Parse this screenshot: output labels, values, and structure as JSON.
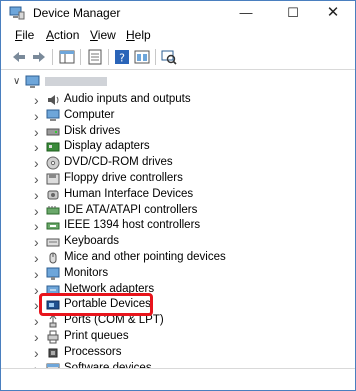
{
  "window": {
    "title": "Device Manager"
  },
  "controls": {
    "minimize": "—",
    "maximize": "☐",
    "close": "✕"
  },
  "menu": [
    {
      "label": "File",
      "u": "F",
      "rest": "ile"
    },
    {
      "label": "Action",
      "u": "A",
      "rest": "ction"
    },
    {
      "label": "View",
      "u": "V",
      "rest": "iew"
    },
    {
      "label": "Help",
      "u": "H",
      "rest": "elp"
    }
  ],
  "tree": {
    "items": [
      {
        "label": "Audio inputs and outputs",
        "icon": "speaker-icon"
      },
      {
        "label": "Computer",
        "icon": "computer-icon"
      },
      {
        "label": "Disk drives",
        "icon": "disk-drive-icon"
      },
      {
        "label": "Display adapters",
        "icon": "display-adapter-icon"
      },
      {
        "label": "DVD/CD-ROM drives",
        "icon": "dvd-icon"
      },
      {
        "label": "Floppy drive controllers",
        "icon": "floppy-icon"
      },
      {
        "label": "Human Interface Devices",
        "icon": "hid-icon"
      },
      {
        "label": "IDE ATA/ATAPI controllers",
        "icon": "ide-icon"
      },
      {
        "label": "IEEE 1394 host controllers",
        "icon": "ieee1394-icon"
      },
      {
        "label": "Keyboards",
        "icon": "keyboard-icon"
      },
      {
        "label": "Mice and other pointing devices",
        "icon": "mouse-icon"
      },
      {
        "label": "Monitors",
        "icon": "monitor-icon"
      },
      {
        "label": "Network adapters",
        "icon": "network-icon"
      },
      {
        "label": "Portable Devices",
        "icon": "portable-device-icon"
      },
      {
        "label": "Ports (COM & LPT)",
        "icon": "port-icon"
      },
      {
        "label": "Print queues",
        "icon": "printer-icon"
      },
      {
        "label": "Processors",
        "icon": "processor-icon"
      },
      {
        "label": "Software devices",
        "icon": "software-device-icon"
      }
    ]
  },
  "colors": {
    "highlight": "#e8141c",
    "accent": "#1f6fbf"
  }
}
